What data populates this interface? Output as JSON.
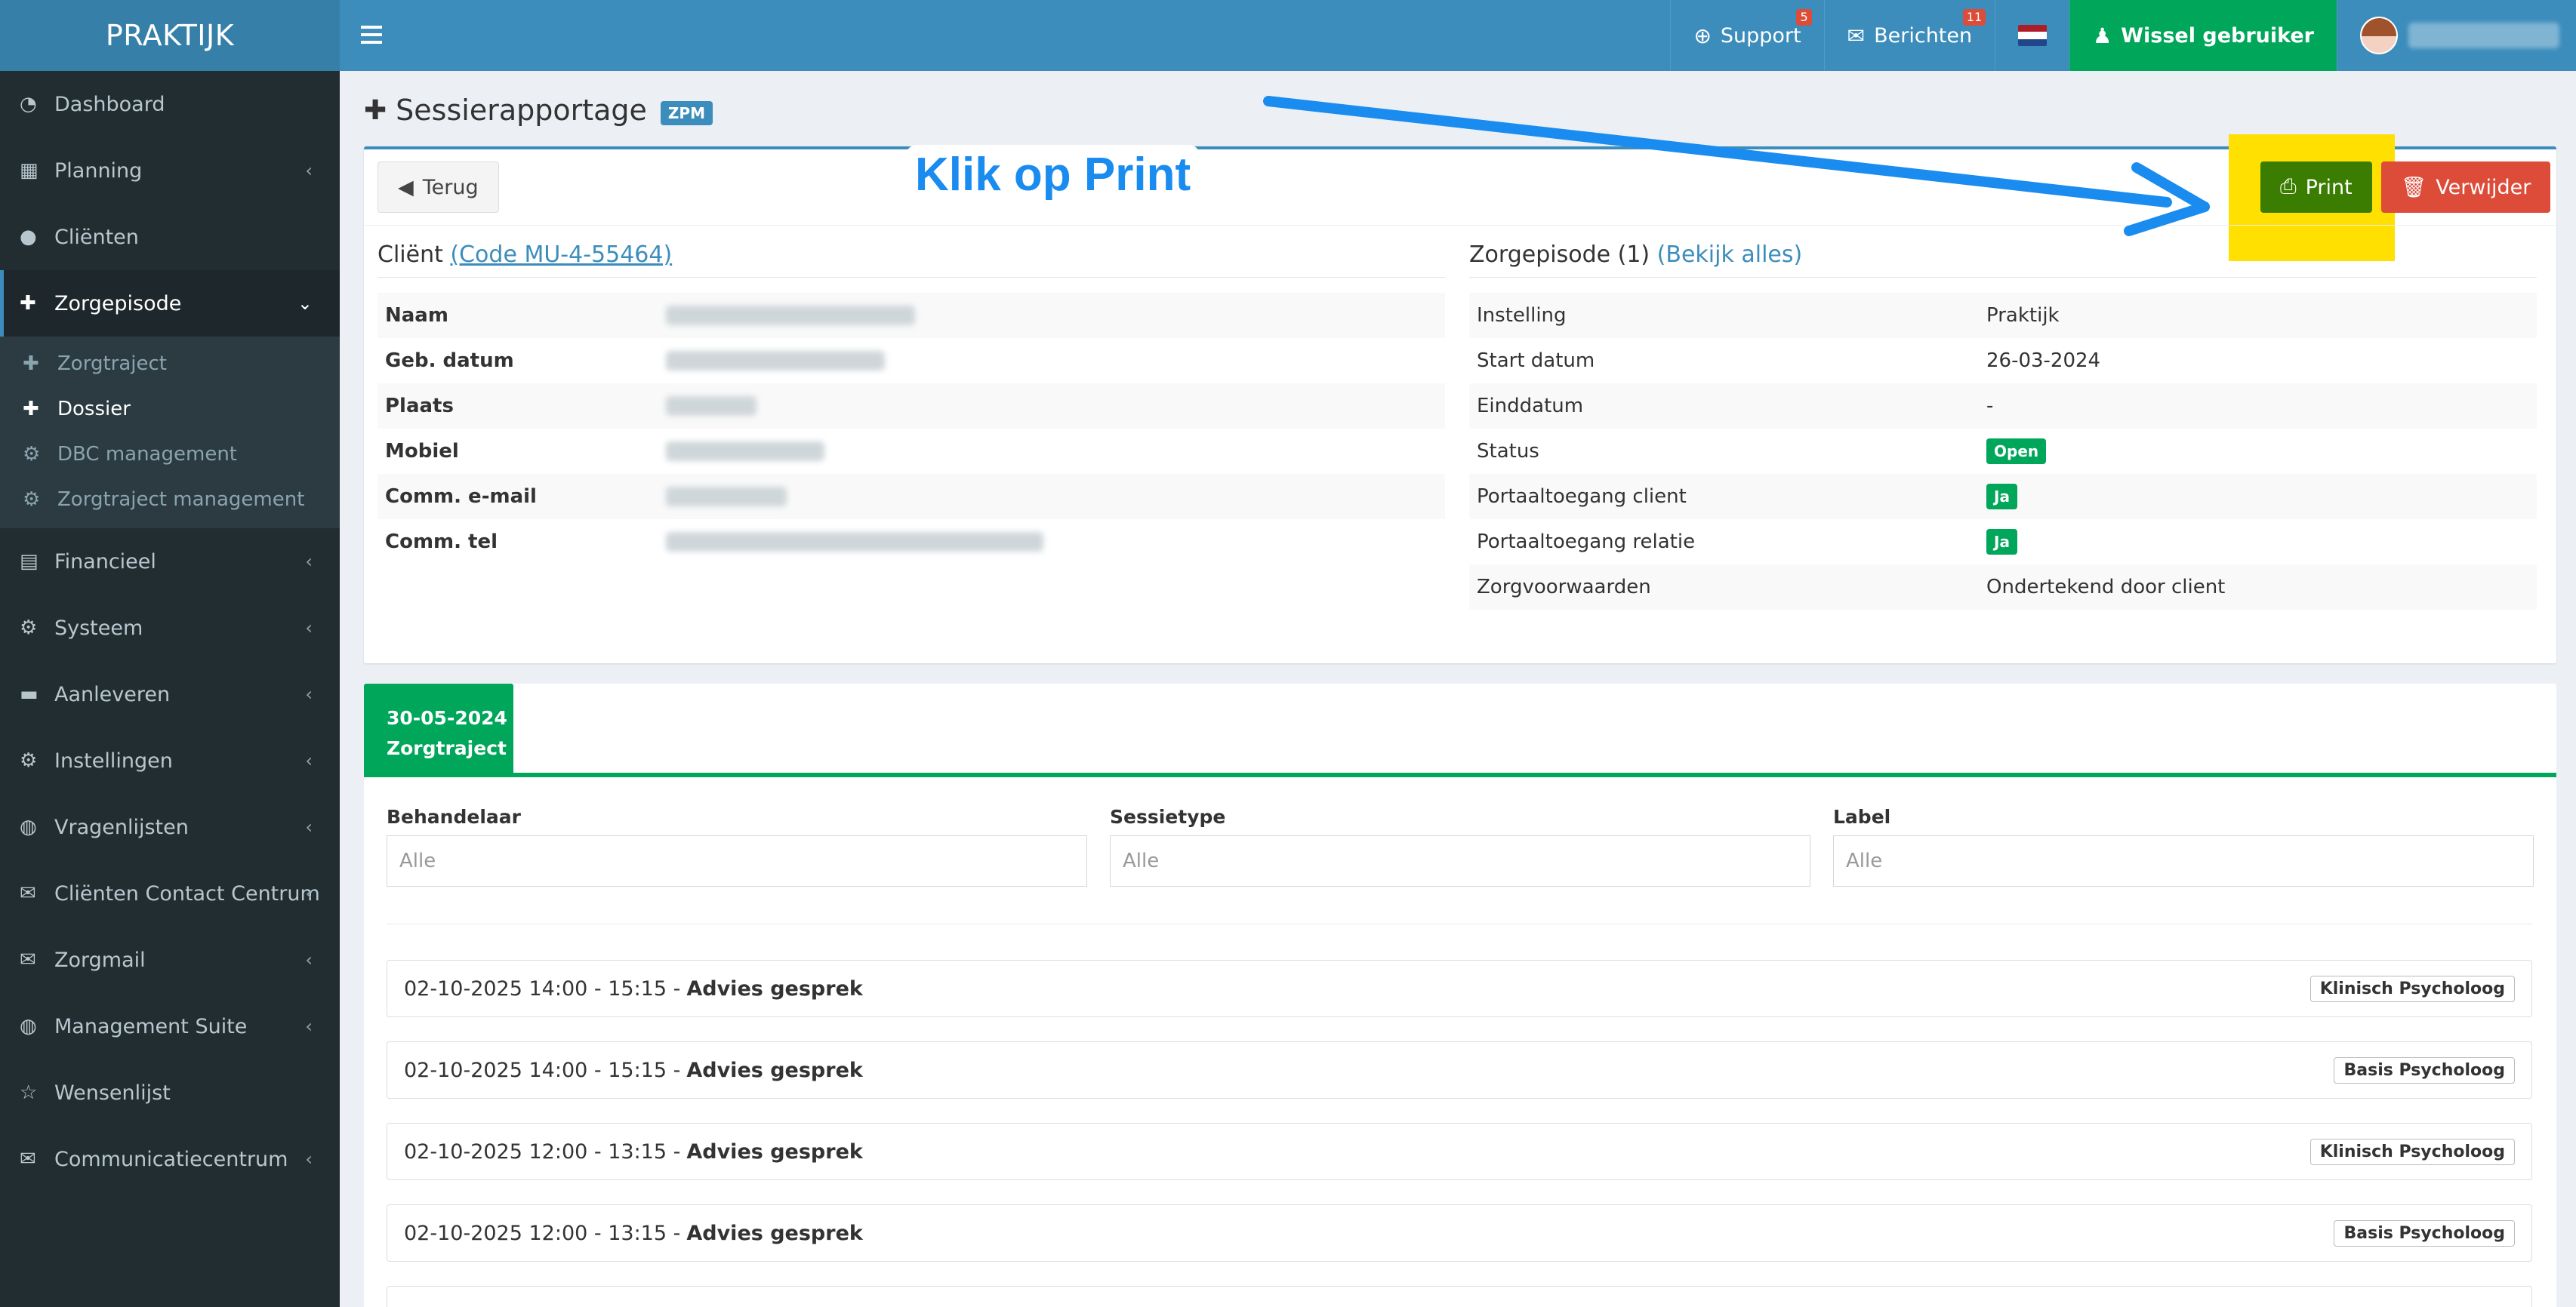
{
  "brand": "PRAKTIJK",
  "topnav": {
    "support": "Support",
    "support_count": "5",
    "berichten": "Berichten",
    "berichten_count": "11",
    "wissel": "Wissel gebruiker"
  },
  "sidebar": {
    "items": [
      {
        "label": "Dashboard"
      },
      {
        "label": "Planning"
      },
      {
        "label": "Cliënten"
      },
      {
        "label": "Zorgepisode"
      },
      {
        "label": "Financieel"
      },
      {
        "label": "Systeem"
      },
      {
        "label": "Aanleveren"
      },
      {
        "label": "Instellingen"
      },
      {
        "label": "Vragenlijsten"
      },
      {
        "label": "Cliënten Contact Centrum"
      },
      {
        "label": "Zorgmail"
      },
      {
        "label": "Management Suite"
      },
      {
        "label": "Wensenlijst"
      },
      {
        "label": "Communicatiecentrum"
      }
    ],
    "sub": [
      {
        "label": "Zorgtraject"
      },
      {
        "label": "Dossier"
      },
      {
        "label": "DBC management"
      },
      {
        "label": "Zorgtraject management"
      }
    ]
  },
  "page": {
    "title": "Sessierapportage",
    "badge": "ZPM"
  },
  "annotation": "Klik op Print",
  "buttons": {
    "terug": "Terug",
    "print": "Print",
    "verwijder": "Verwijder"
  },
  "client": {
    "heading": "Cliënt",
    "code": "(Code MU-4-55464)",
    "rows": [
      {
        "k": "Naam"
      },
      {
        "k": "Geb. datum"
      },
      {
        "k": "Plaats"
      },
      {
        "k": "Mobiel"
      },
      {
        "k": "Comm. e-mail"
      },
      {
        "k": "Comm. tel"
      }
    ]
  },
  "episode": {
    "heading": "Zorgepisode (1)",
    "link": "(Bekijk alles)",
    "rows": [
      {
        "k": "Instelling",
        "v": "Praktijk"
      },
      {
        "k": "Start datum",
        "v": "26-03-2024"
      },
      {
        "k": "Einddatum",
        "v": "-"
      },
      {
        "k": "Status",
        "v": "Open"
      },
      {
        "k": "Portaaltoegang client",
        "v": "Ja"
      },
      {
        "k": "Portaaltoegang relatie",
        "v": "Ja"
      },
      {
        "k": "Zorgvoorwaarden",
        "v": "Ondertekend door client"
      }
    ]
  },
  "tab": {
    "date": "30-05-2024",
    "label": "Zorgtraject"
  },
  "filters": [
    {
      "label": "Behandelaar",
      "placeholder": "Alle"
    },
    {
      "label": "Sessietype",
      "placeholder": "Alle"
    },
    {
      "label": "Label",
      "placeholder": "Alle"
    }
  ],
  "sessions": [
    {
      "time": "02-10-2025 14:00 - 15:15 -",
      "type": "Advies gesprek",
      "tag": "Klinisch Psycholoog"
    },
    {
      "time": "02-10-2025 14:00 - 15:15 -",
      "type": "Advies gesprek",
      "tag": "Basis Psycholoog"
    },
    {
      "time": "02-10-2025 12:00 - 13:15 -",
      "type": "Advies gesprek",
      "tag": "Klinisch Psycholoog"
    },
    {
      "time": "02-10-2025 12:00 - 13:15 -",
      "type": "Advies gesprek",
      "tag": "Basis Psycholoog"
    }
  ],
  "colors": {
    "primary": "#3c8dbc",
    "success": "#00a65a",
    "danger": "#dd4b39",
    "sidebar": "#222d32",
    "highlight": "#ffe000"
  }
}
